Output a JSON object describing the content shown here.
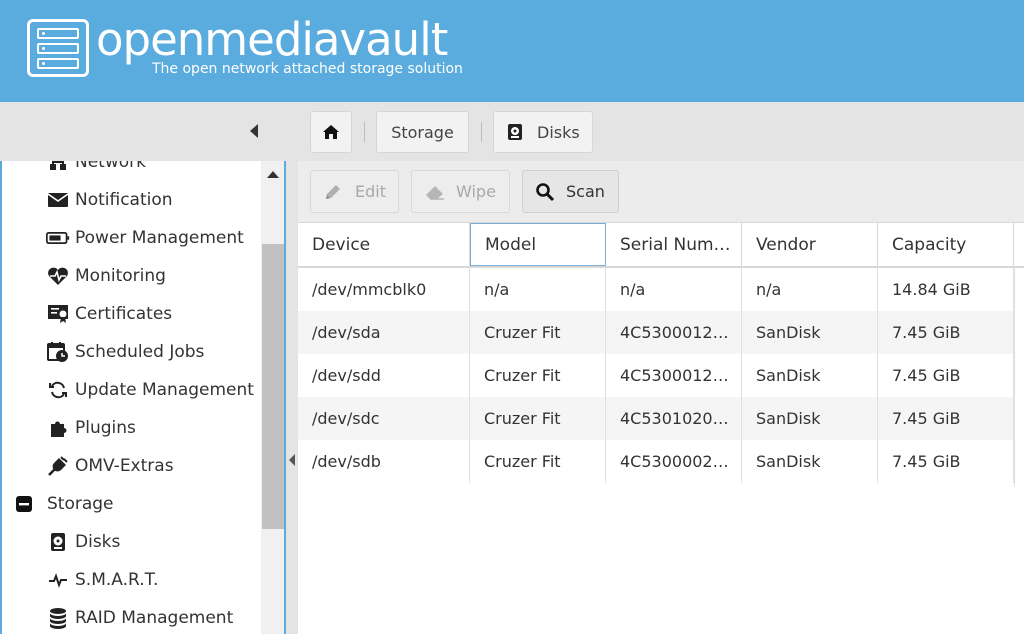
{
  "brand": {
    "title": "openmediavault",
    "subtitle": "The open network attached storage solution",
    "header_color": "#5aabde"
  },
  "breadcrumb": {
    "home_icon": "home-icon",
    "items": [
      {
        "label": "Storage"
      },
      {
        "label": "Disks",
        "icon": "disk-icon"
      }
    ]
  },
  "sidebar": {
    "items": [
      {
        "label": "Network",
        "icon": "network-icon"
      },
      {
        "label": "Notification",
        "icon": "envelope-icon"
      },
      {
        "label": "Power Management",
        "icon": "battery-icon"
      },
      {
        "label": "Monitoring",
        "icon": "heartbeat-icon"
      },
      {
        "label": "Certificates",
        "icon": "certificate-icon"
      },
      {
        "label": "Scheduled Jobs",
        "icon": "calendar-clock-icon"
      },
      {
        "label": "Update Management",
        "icon": "sync-icon"
      },
      {
        "label": "Plugins",
        "icon": "puzzle-icon"
      },
      {
        "label": "OMV-Extras",
        "icon": "plug-icon"
      }
    ],
    "group": {
      "label": "Storage",
      "icon": "minus-square-icon"
    },
    "sub_items": [
      {
        "label": "Disks",
        "icon": "disk-icon"
      },
      {
        "label": "S.M.A.R.T.",
        "icon": "pulse-icon"
      },
      {
        "label": "RAID Management",
        "icon": "database-icon"
      }
    ]
  },
  "toolbar": {
    "edit_label": "Edit",
    "wipe_label": "Wipe",
    "scan_label": "Scan"
  },
  "table": {
    "columns": [
      "Device",
      "Model",
      "Serial Num…",
      "Vendor",
      "Capacity"
    ],
    "rows": [
      [
        "/dev/mmcblk0",
        "n/a",
        "n/a",
        "n/a",
        "14.84 GiB"
      ],
      [
        "/dev/sda",
        "Cruzer Fit",
        "4C5300012…",
        "SanDisk",
        "7.45 GiB"
      ],
      [
        "/dev/sdd",
        "Cruzer Fit",
        "4C5300012…",
        "SanDisk",
        "7.45 GiB"
      ],
      [
        "/dev/sdc",
        "Cruzer Fit",
        "4C5301020…",
        "SanDisk",
        "7.45 GiB"
      ],
      [
        "/dev/sdb",
        "Cruzer Fit",
        "4C5300002…",
        "SanDisk",
        "7.45 GiB"
      ]
    ]
  }
}
